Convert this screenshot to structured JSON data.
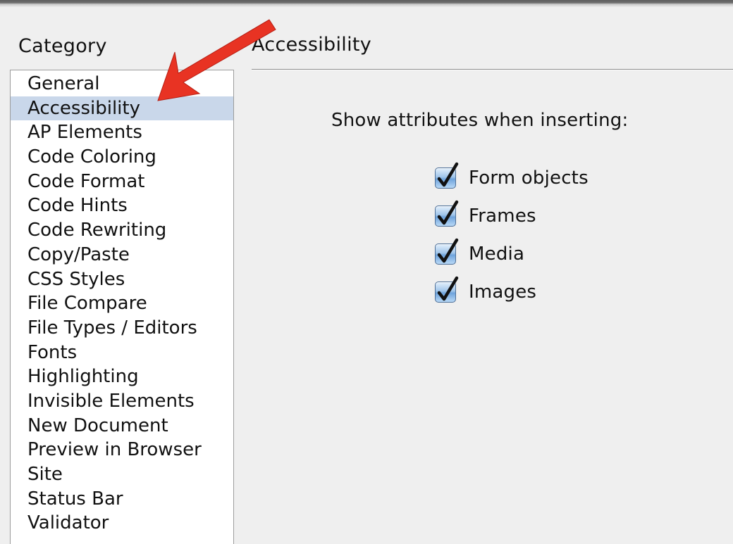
{
  "category_panel": {
    "label": "Category",
    "selected_index": 1,
    "items": [
      "General",
      "Accessibility",
      "AP Elements",
      "Code Coloring",
      "Code Format",
      "Code Hints",
      "Code Rewriting",
      "Copy/Paste",
      "CSS Styles",
      "File Compare",
      "File Types / Editors",
      "Fonts",
      "Highlighting",
      "Invisible Elements",
      "New Document",
      "Preview in Browser",
      "Site",
      "Status Bar",
      "Validator"
    ]
  },
  "settings_panel": {
    "title": "Accessibility",
    "section_heading": "Show attributes when inserting:",
    "options": [
      {
        "label": "Form objects",
        "checked": true
      },
      {
        "label": "Frames",
        "checked": true
      },
      {
        "label": "Media",
        "checked": true
      },
      {
        "label": "Images",
        "checked": true
      }
    ]
  },
  "colors": {
    "selection": "#c9d7ea",
    "annotation_arrow": "#e83323",
    "checkbox_blue": "#6ea3dc"
  },
  "icons": {
    "checkmark": "checkmark-icon",
    "annotation": "red-arrow-icon"
  }
}
